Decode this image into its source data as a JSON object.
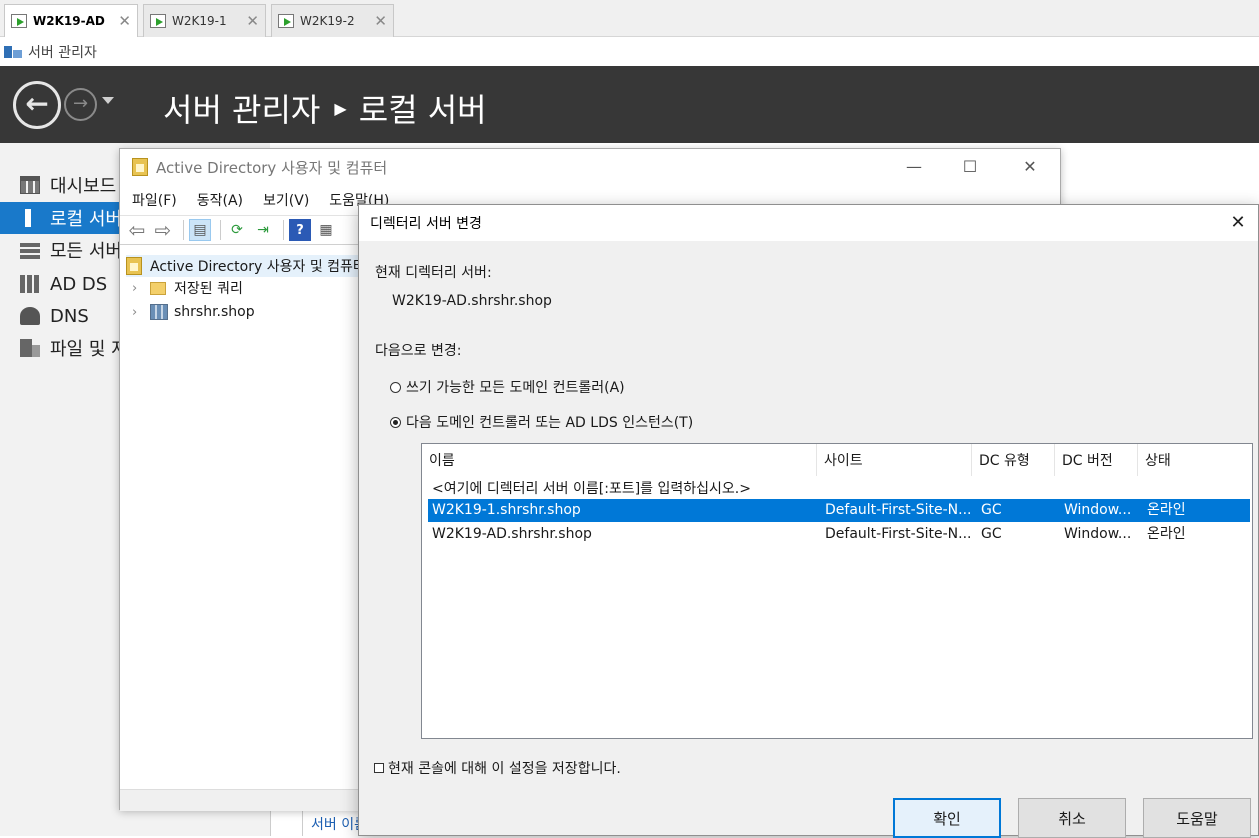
{
  "vm_tabs": [
    {
      "label": "W2K19-AD",
      "active": true
    },
    {
      "label": "W2K19-1",
      "active": false
    },
    {
      "label": "W2K19-2",
      "active": false
    }
  ],
  "server_manager": {
    "window_title": "서버 관리자",
    "breadcrumb": {
      "root": "서버 관리자",
      "current": "로컬 서버"
    },
    "nav_items": [
      {
        "label": "대시보드",
        "icon": "dashboard-icon",
        "active": false
      },
      {
        "label": "로컬 서버",
        "icon": "local-server-icon",
        "active": true
      },
      {
        "label": "모든 서버",
        "icon": "all-servers-icon",
        "active": false
      },
      {
        "label": "AD DS",
        "icon": "ad-ds-icon",
        "active": false
      },
      {
        "label": "DNS",
        "icon": "dns-icon",
        "active": false
      },
      {
        "label": "파일 및 저장소 서비스",
        "icon": "file-storage-icon",
        "active": false
      }
    ],
    "bottom_link": "서버 이름"
  },
  "aduc": {
    "title": "Active Directory 사용자 및 컴퓨터",
    "menu": [
      "파일(F)",
      "동작(A)",
      "보기(V)",
      "도움말(H)"
    ],
    "tree": {
      "root": "Active Directory 사용자 및 컴퓨터",
      "items": [
        "저장된 쿼리",
        "shrshr.shop"
      ]
    }
  },
  "dialog": {
    "title": "디렉터리 서버 변경",
    "current_label": "현재 디렉터리 서버:",
    "current_value": "W2K19-AD.shrshr.shop",
    "change_to_label": "다음으로 변경:",
    "radio_any": "쓰기 가능한 모든 도메인 컨트롤러(A)",
    "radio_specific": "다음 도메인 컨트롤러 또는 AD LDS 인스턴스(T)",
    "selected_radio": "specific",
    "columns": [
      "이름",
      "사이트",
      "DC 유형",
      "DC 버전",
      "상태"
    ],
    "placeholder": "<여기에 디렉터리 서버 이름[:포트]를 입력하십시오.>",
    "rows": [
      {
        "name": "W2K19-1.shrshr.shop",
        "site": "Default-First-Site-N...",
        "dc_type": "GC",
        "dc_version": "Window...",
        "status": "온라인",
        "selected": true
      },
      {
        "name": "W2K19-AD.shrshr.shop",
        "site": "Default-First-Site-N...",
        "dc_type": "GC",
        "dc_version": "Window...",
        "status": "온라인",
        "selected": false
      }
    ],
    "save_checkbox": "현재 콘솔에 대해 이 설정을 저장합니다.",
    "save_checked": false,
    "buttons": {
      "ok": "확인",
      "cancel": "취소",
      "help": "도움말"
    }
  },
  "colors": {
    "header_bg": "#373737",
    "nav_active": "#1979ca",
    "selection": "#0078d7"
  }
}
